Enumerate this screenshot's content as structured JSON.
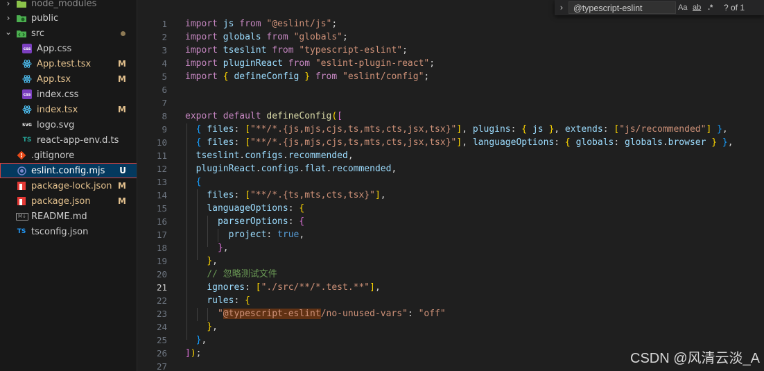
{
  "explorer": {
    "items": [
      {
        "label": "node_modules",
        "chevron": "›",
        "icon": "folder-node-icon",
        "badge": ""
      },
      {
        "label": "public",
        "chevron": "›",
        "icon": "folder-public-icon",
        "badge": ""
      },
      {
        "label": "src",
        "chevron": "⌄",
        "icon": "folder-src-icon",
        "badge": "dot"
      },
      {
        "label": "App.css",
        "icon": "css-file-icon",
        "icon_text": "css",
        "badge": ""
      },
      {
        "label": "App.test.tsx",
        "icon": "react-file-icon",
        "badge": "M"
      },
      {
        "label": "App.tsx",
        "icon": "react-file-icon",
        "badge": "M"
      },
      {
        "label": "index.css",
        "icon": "css-file-icon",
        "icon_text": "css",
        "badge": ""
      },
      {
        "label": "index.tsx",
        "icon": "react-file-icon",
        "badge": "M"
      },
      {
        "label": "logo.svg",
        "icon": "svg-file-icon",
        "icon_text": "SVG",
        "badge": ""
      },
      {
        "label": "react-app-env.d.ts",
        "icon": "ts-file-icon",
        "icon_text": "TS",
        "badge": ""
      },
      {
        "label": ".gitignore",
        "icon": "git-file-icon",
        "badge": ""
      },
      {
        "label": "eslint.config.mjs",
        "icon": "eslint-file-icon",
        "badge": "U"
      },
      {
        "label": "package-lock.json",
        "icon": "npm-file-icon",
        "badge": "M"
      },
      {
        "label": "package.json",
        "icon": "npm-file-icon",
        "badge": "M"
      },
      {
        "label": "README.md",
        "icon": "markdown-file-icon",
        "icon_text": "M↓",
        "badge": ""
      },
      {
        "label": "tsconfig.json",
        "icon": "tsconfig-file-icon",
        "icon_text": "TS",
        "badge": ""
      }
    ]
  },
  "find_widget": {
    "toggle": "›",
    "query": "@typescript-eslint",
    "match_case": "Aa",
    "whole_word": "ab",
    "regex": ".*",
    "count": "? of 1"
  },
  "editor": {
    "current_line": 21,
    "line_numbers": [
      "1",
      "2",
      "3",
      "4",
      "5",
      "6",
      "7",
      "8",
      "9",
      "10",
      "11",
      "12",
      "13",
      "14",
      "15",
      "16",
      "17",
      "18",
      "19",
      "20",
      "21",
      "22",
      "23",
      "24",
      "25",
      "26",
      "27"
    ],
    "code": {
      "l1": [
        "import",
        " ",
        "js",
        " ",
        "from",
        " ",
        "\"@eslint/js\"",
        ";"
      ],
      "l2": [
        "import",
        " ",
        "globals",
        " ",
        "from",
        " ",
        "\"globals\"",
        ";"
      ],
      "l3": [
        "import",
        " ",
        "tseslint",
        " ",
        "from",
        " ",
        "\"typescript-eslint\"",
        ";"
      ],
      "l4": [
        "import",
        " ",
        "pluginReact",
        " ",
        "from",
        " ",
        "\"eslint-plugin-react\"",
        ";"
      ],
      "l5": [
        "import",
        " ",
        "{",
        " ",
        "defineConfig",
        " ",
        "}",
        " ",
        "from",
        " ",
        "\"eslint/config\"",
        ";"
      ],
      "l8": [
        "export",
        " ",
        "default",
        " ",
        "defineConfig",
        "(",
        "["
      ],
      "l9": [
        "  ",
        "{",
        " ",
        "files",
        ": ",
        "[",
        "\"**/*.{js,mjs,cjs,ts,mts,cts,jsx,tsx}\"",
        "]",
        ", ",
        "plugins",
        ": ",
        "{",
        " ",
        "js",
        " ",
        "}",
        ", ",
        "extends",
        ": ",
        "[",
        "\"js/recommended\"",
        "]",
        " ",
        "}",
        ","
      ],
      "l10": [
        "  ",
        "{",
        " ",
        "files",
        ": ",
        "[",
        "\"**/*.{js,mjs,cjs,ts,mts,cts,jsx,tsx}\"",
        "]",
        ", ",
        "languageOptions",
        ": ",
        "{",
        " ",
        "globals",
        ": ",
        "globals",
        ".",
        "browser",
        " ",
        "}",
        " ",
        "}",
        ","
      ],
      "l11": [
        "  ",
        "tseslint",
        ".",
        "configs",
        ".",
        "recommended",
        ","
      ],
      "l12": [
        "  ",
        "pluginReact",
        ".",
        "configs",
        ".",
        "flat",
        ".",
        "recommended",
        ","
      ],
      "l13": [
        "  ",
        "{"
      ],
      "l14": [
        "    ",
        "files",
        ": ",
        "[",
        "\"**/*.{ts,mts,cts,tsx}\"",
        "]",
        ","
      ],
      "l15": [
        "    ",
        "languageOptions",
        ": ",
        "{"
      ],
      "l16": [
        "      ",
        "parserOptions",
        ": ",
        "{"
      ],
      "l17": [
        "        ",
        "project",
        ": ",
        "true",
        ","
      ],
      "l18": [
        "      ",
        "}",
        ","
      ],
      "l19": [
        "    ",
        "}",
        ","
      ],
      "l20": [
        "    ",
        "// 忽略测试文件"
      ],
      "l21": [
        "    ",
        "ignores",
        ": ",
        "[",
        "\"./src/**/*.test.**\"",
        "]",
        ","
      ],
      "l22": [
        "    ",
        "rules",
        ": ",
        "{"
      ],
      "l23": [
        "      ",
        "\"",
        "@typescript-eslint",
        "/no-unused-vars\"",
        ": ",
        "\"off\""
      ],
      "l24": [
        "    ",
        "}",
        ","
      ],
      "l25": [
        "  ",
        "}",
        ","
      ],
      "l26": [
        "]",
        ")",
        ";"
      ]
    }
  },
  "watermark": "CSDN @风清云淡_A",
  "colors": {
    "modified": "#e2c08d",
    "untracked": "#73c991",
    "selection_outline": "#d9413b",
    "find_highlight": "#613214"
  }
}
